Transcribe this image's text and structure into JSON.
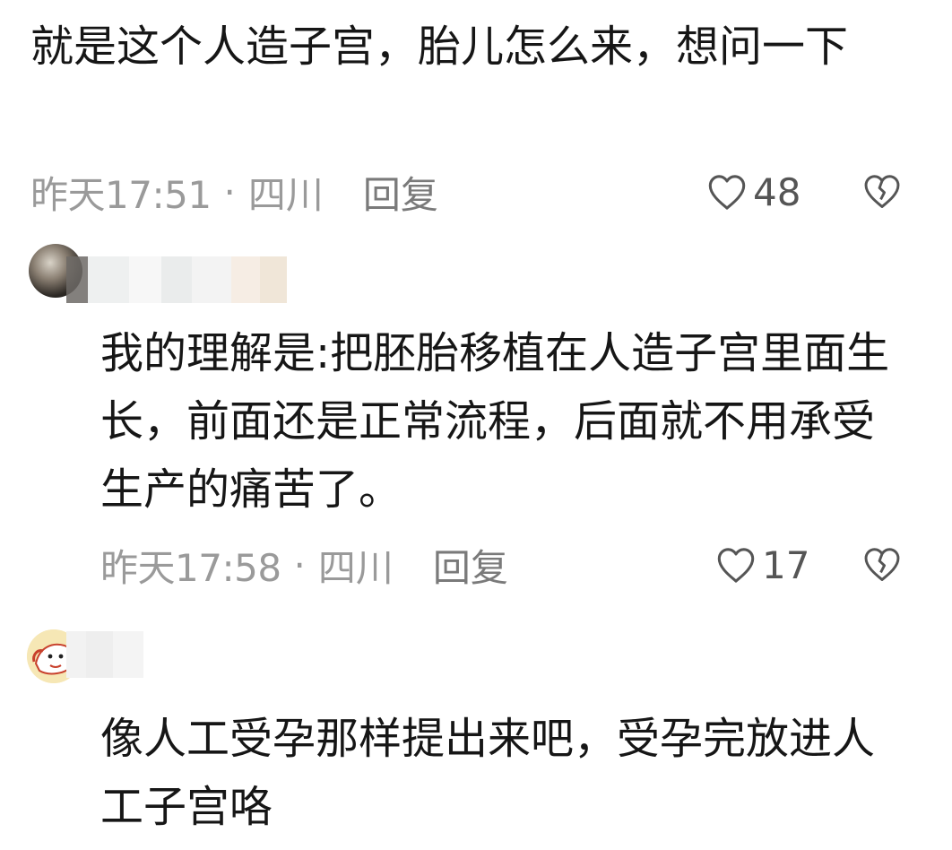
{
  "comments": [
    {
      "text": "就是这个人造子宫，胎儿怎么来，想问一下",
      "time": "昨天17:51",
      "location": "四川",
      "reply_label": "回复",
      "likes": "48"
    },
    {
      "text": "我的理解是:把胚胎移植在人造子宫里面生长，前面还是正常流程，后面就不用承受生产的痛苦了。",
      "time": "昨天17:58",
      "location": "四川",
      "reply_label": "回复",
      "likes": "17"
    },
    {
      "text": "像人工受孕那样提出来吧，受孕完放进人工子宫咯"
    }
  ],
  "separator": "·",
  "icons": {
    "like": "heart-outline-icon",
    "dislike": "broken-heart-icon"
  }
}
